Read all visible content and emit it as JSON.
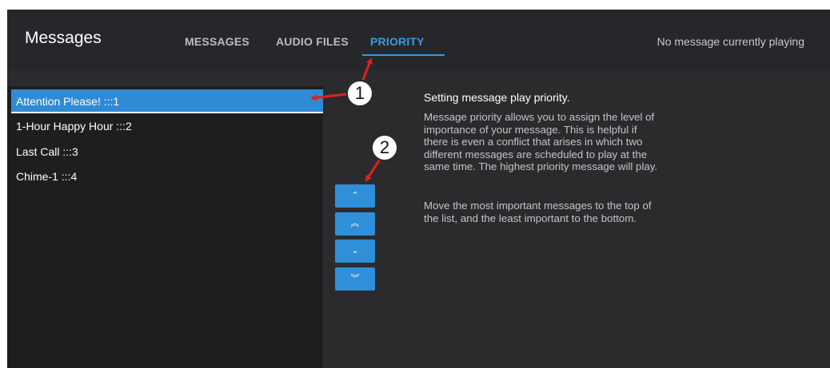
{
  "header": {
    "title": "Messages",
    "tabs": [
      {
        "label": "MESSAGES"
      },
      {
        "label": "AUDIO FILES"
      },
      {
        "label": "PRIORITY"
      }
    ],
    "status": "No message currently playing"
  },
  "message_list": {
    "items": [
      {
        "label": "Attention Please! :::1"
      },
      {
        "label": "1-Hour Happy Hour :::2"
      },
      {
        "label": "Last Call :::3"
      },
      {
        "label": "Chime-1 :::4"
      }
    ],
    "selected": "Attention Please! :::1"
  },
  "priority_controls": {
    "buttons": [
      {
        "icon": "chevron-up-icon",
        "glyph": "⌃"
      },
      {
        "icon": "double-chevron-up-icon",
        "glyph": "︽"
      },
      {
        "icon": "chevron-down-icon",
        "glyph": "⌄"
      },
      {
        "icon": "double-chevron-down-icon",
        "glyph": "︾"
      }
    ]
  },
  "help": {
    "title": "Setting message play priority.",
    "paragraph1": "Message priority allows you to assign the level of importance of your message. This is helpful if there is even a conflict that arises in which two different messages are scheduled to play at the same time. The highest priority message will play.",
    "paragraph2": "Move the most important messages to the top of the list, and the least important to the bottom."
  },
  "annotations": {
    "callout1": "1",
    "callout2": "2",
    "arrow_color": "#e0211b"
  },
  "colors": {
    "accent": "#2f8bd5",
    "background": "#2b2b2d",
    "list_background": "#1d1e20"
  }
}
